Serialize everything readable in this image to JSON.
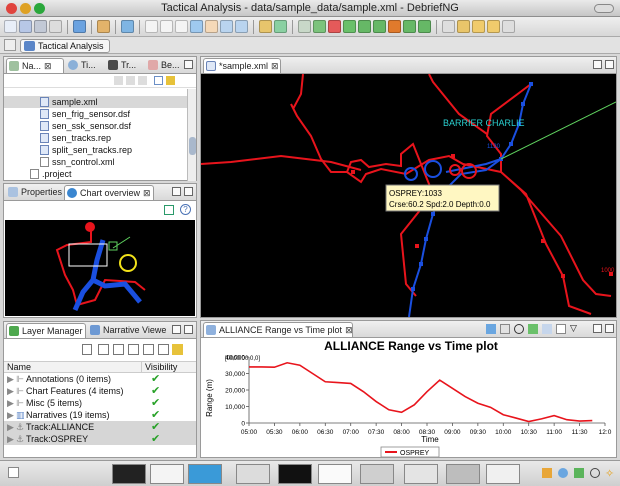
{
  "window": {
    "title": "Tactical Analysis - data/sample_data/sample.xml - DebriefNG"
  },
  "perspective": {
    "label": "Tactical Analysis"
  },
  "navigator": {
    "tabs": [
      {
        "label": "Na...",
        "active": true
      },
      {
        "label": "Ti..."
      },
      {
        "label": "Tr..."
      },
      {
        "label": "Be..."
      }
    ],
    "files": [
      {
        "name": "sample.xml",
        "selected": true
      },
      {
        "name": "sen_frig_sensor.dsf"
      },
      {
        "name": "sen_ssk_sensor.dsf"
      },
      {
        "name": "sen_tracks.rep"
      },
      {
        "name": "split_sen_tracks.rep"
      },
      {
        "name": "ssn_control.xml"
      },
      {
        "name": ".project"
      }
    ]
  },
  "overview": {
    "tabs": [
      {
        "label": "Properties"
      },
      {
        "label": "Chart overview",
        "active": true
      }
    ]
  },
  "layers": {
    "tabs": [
      {
        "label": "Layer Manager",
        "active": true
      },
      {
        "label": "Narrative Viewer"
      }
    ],
    "columns": {
      "name": "Name",
      "visibility": "Visibility"
    },
    "rows": [
      {
        "label": "Annotations (0 items)",
        "visible": "✔"
      },
      {
        "label": "Chart Features (4 items)",
        "visible": "✔"
      },
      {
        "label": "Misc (5 items)",
        "visible": "✔"
      },
      {
        "label": "Narratives (19 items)",
        "visible": "✔"
      },
      {
        "label": "Track:ALLIANCE",
        "visible": "✔"
      },
      {
        "label": "Track:OSPREY",
        "visible": "✔"
      }
    ]
  },
  "editor": {
    "tab_label": "*sample.xml",
    "labels": {
      "barrier": "BARRIER CHARLIE",
      "tooltip_line1": "OSPREY:1033",
      "tooltip_line2": "Crse:60.2 Spd:2.0 Depth:0.0",
      "time1": "1130",
      "time2": "1000"
    }
  },
  "plot": {
    "tab_label": "ALLIANCE Range vs Time plot",
    "origin_label": "[0000:00,0,0]",
    "legend_label": "OSPREY"
  },
  "colors": {
    "track_red": "#e8141c",
    "track_blue": "#1a4fe0",
    "barrier_cyan": "#2ad0d0",
    "barrier_green": "#5fd25f",
    "tooltip_bg": "#fff7c2",
    "marker_yellow": "#f2e21a"
  },
  "chart_data": {
    "type": "line",
    "title": "ALLIANCE Range vs Time plot",
    "xlabel": "Time",
    "ylabel": "Range (m)",
    "ylim": [
      0,
      40000
    ],
    "yticks": [
      "0",
      "10,000",
      "20,000",
      "30,000",
      "40,000"
    ],
    "xticks": [
      "05:00",
      "05:30",
      "06:00",
      "06:30",
      "07:00",
      "07:30",
      "08:00",
      "08:30",
      "09:00",
      "09:30",
      "10:00",
      "10:30",
      "11:00",
      "11:30",
      "12:0"
    ],
    "grid": false,
    "legend": "bottom-center",
    "series": [
      {
        "name": "OSPREY",
        "x": [
          "05:00",
          "05:15",
          "05:30",
          "05:45",
          "06:00",
          "06:15",
          "06:30",
          "06:45",
          "07:00",
          "07:15",
          "07:30",
          "07:45",
          "08:00",
          "08:15",
          "08:30",
          "08:45",
          "09:00",
          "09:15",
          "09:30",
          "09:45",
          "10:00",
          "10:15",
          "10:30",
          "10:45",
          "11:00",
          "11:15",
          "11:30",
          "11:45"
        ],
        "y": [
          34000,
          34000,
          33800,
          36500,
          35000,
          30000,
          25000,
          24500,
          24000,
          19000,
          13000,
          8000,
          6500,
          11000,
          19000,
          26000,
          21000,
          16000,
          12000,
          9500,
          5000,
          3000,
          900,
          2500,
          4500,
          2000,
          1200,
          1500
        ]
      }
    ]
  }
}
